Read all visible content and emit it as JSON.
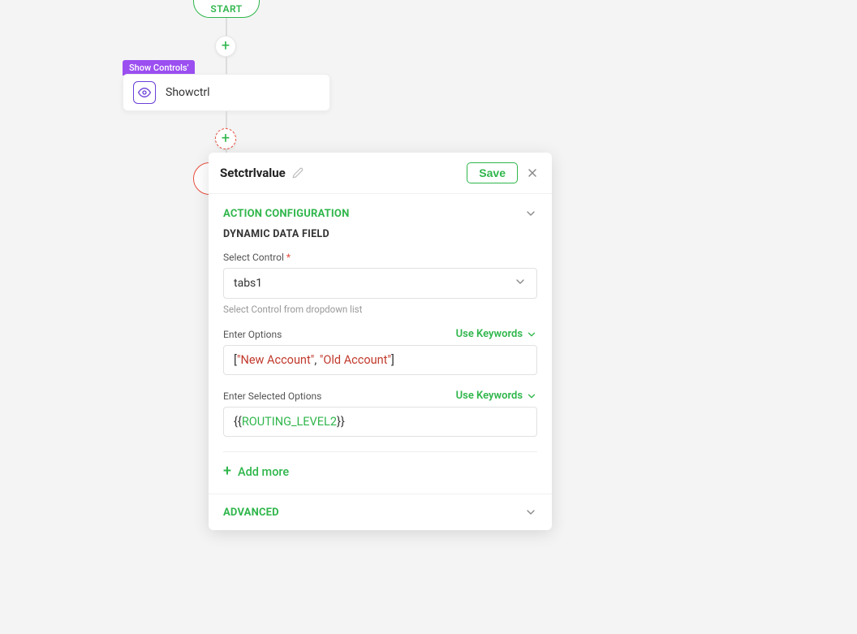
{
  "flow": {
    "start_label": "START",
    "badge": "Show Controls'",
    "node_label": "Showctrl"
  },
  "panel": {
    "title": "Setctrlvalue",
    "save_label": "Save",
    "sections": {
      "action_config": "ACTION CONFIGURATION",
      "advanced": "ADVANCED"
    },
    "dynamic_heading": "DYNAMIC DATA FIELD",
    "fields": {
      "select_control": {
        "label": "Select Control",
        "value": "tabs1",
        "hint": "Select Control from dropdown list"
      },
      "enter_options": {
        "label": "Enter Options",
        "use_keywords": "Use Keywords",
        "bracket_open": "[",
        "str1": "\"New Account\"",
        "comma": ", ",
        "str2": "\"Old Account\"",
        "bracket_close": "]"
      },
      "enter_selected": {
        "label": "Enter Selected Options",
        "use_keywords": "Use Keywords",
        "curly_open": "{{",
        "var": "ROUTING_LEVEL2",
        "curly_close": "}}"
      }
    },
    "add_more": "Add more"
  }
}
